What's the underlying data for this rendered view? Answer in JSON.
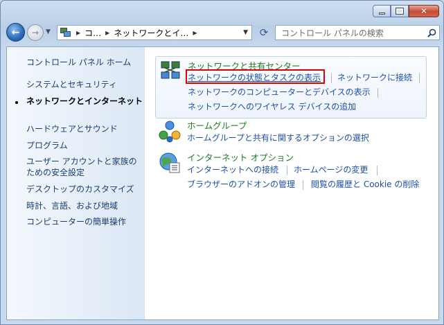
{
  "window": {
    "address": {
      "crumbs": [
        "コ…",
        "ネットワークとイ…"
      ]
    },
    "search_placeholder": "コントロール パネルの検索"
  },
  "sidebar": {
    "items": [
      {
        "label": "コントロール パネル ホーム"
      },
      {
        "label": "システムとセキュリティ"
      },
      {
        "label": "ネットワークとインターネット",
        "active": true
      },
      {
        "label": "ハードウェアとサウンド"
      },
      {
        "label": "プログラム"
      },
      {
        "label": "ユーザー アカウントと家族のための安全設定"
      },
      {
        "label": "デスクトップのカスタマイズ"
      },
      {
        "label": "時計、言語、および地域"
      },
      {
        "label": "コンピューターの簡単操作"
      }
    ]
  },
  "categories": [
    {
      "title": "ネットワークと共有センター",
      "links": [
        "ネットワークの状態とタスクの表示",
        "ネットワークに接続",
        "ネットワークのコンピューターとデバイスの表示",
        "ネットワークへのワイヤレス デバイスの追加"
      ]
    },
    {
      "title": "ホームグループ",
      "links": [
        "ホームグループと共有に関するオプションの選択"
      ]
    },
    {
      "title": "インターネット オプション",
      "links": [
        "インターネットへの接続",
        "ホームページの変更",
        "ブラウザーのアドオンの管理",
        "閲覧の履歴と Cookie の削除"
      ]
    }
  ]
}
